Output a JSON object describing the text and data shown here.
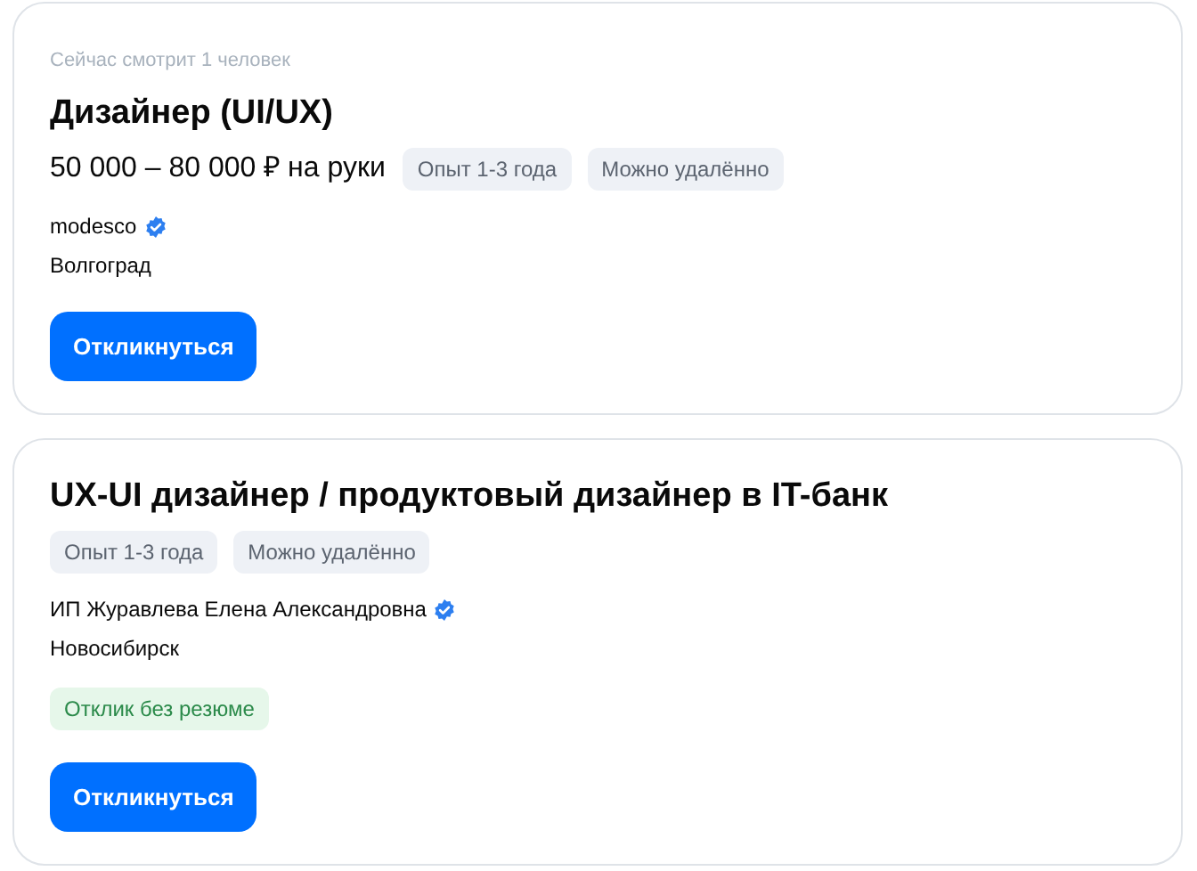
{
  "vacancies": [
    {
      "viewers": "Сейчас смотрит 1 человек",
      "title": "Дизайнер (UI/UX)",
      "salary": "50 000 – 80 000 ₽ на руки",
      "tags": [
        {
          "text": "Опыт 1-3 года",
          "kind": "info"
        },
        {
          "text": "Можно удалённо",
          "kind": "info"
        }
      ],
      "company": "modesco",
      "verified": true,
      "city": "Волгоград",
      "button": "Откликнуться"
    },
    {
      "title": "UX-UI дизайнер / продуктовый дизайнер в IT-банк",
      "tags": [
        {
          "text": "Опыт 1-3 года",
          "kind": "info"
        },
        {
          "text": "Можно удалённо",
          "kind": "info"
        }
      ],
      "company": "ИП Журавлева Елена Александровна",
      "verified": true,
      "city": "Новосибирск",
      "badges": [
        {
          "text": "Отклик без резюме",
          "kind": "success"
        }
      ],
      "button": "Откликнуться"
    }
  ]
}
